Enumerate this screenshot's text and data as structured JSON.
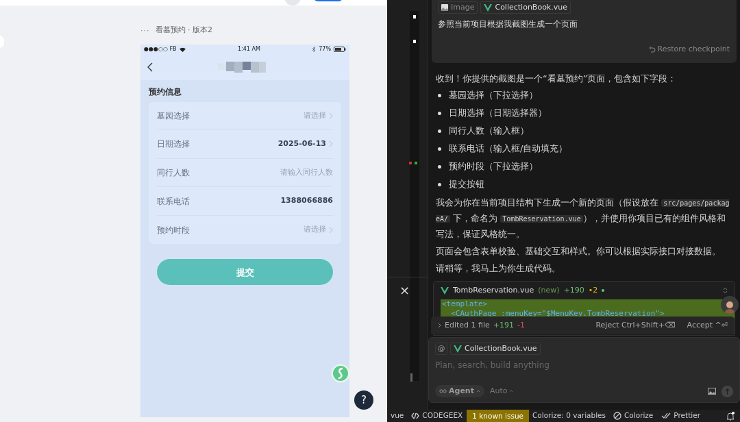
{
  "preview": {
    "more": "···",
    "breadcrumb": "看墓预约 · 版本2",
    "phone": {
      "status": {
        "carrier": "●●●○○ FB",
        "time": "1:41 AM",
        "battery": "77%"
      },
      "section_title": "预约信息",
      "fields": [
        {
          "label": "墓园选择",
          "kind": "select",
          "placeholder": "请选择"
        },
        {
          "label": "日期选择",
          "kind": "select",
          "value": "2025-06-13"
        },
        {
          "label": "同行人数",
          "kind": "input",
          "placeholder": "请输入同行人数"
        },
        {
          "label": "联系电话",
          "kind": "input",
          "value": "1388066886"
        },
        {
          "label": "预约时段",
          "kind": "select",
          "placeholder": "请选择"
        }
      ],
      "submit": "提交"
    },
    "help": "?"
  },
  "chat": {
    "user_message": {
      "attachments": [
        {
          "kind": "image",
          "label": "Image"
        },
        {
          "kind": "vue",
          "label": "CollectionBook.vue"
        }
      ],
      "text": "参照当前项目根据我截图生成一个页面",
      "restore": "Restore checkpoint"
    },
    "reply": {
      "intro": "收到！你提供的截图是一个“看墓预约”页面，包含如下字段：",
      "bullets": [
        "墓园选择（下拉选择）",
        "日期选择（日期选择器）",
        "同行人数（输入框）",
        "联系电话（输入框/自动填充）",
        "预约时段（下拉选择）",
        "提交按钮"
      ],
      "paragraphs": [
        [
          {
            "kind": "text",
            "text": "我会为你在当前项目结构下生成一个新的页面（假设放在 "
          },
          {
            "kind": "code",
            "text": "src/pages/packageA/"
          },
          {
            "kind": "text",
            "text": " 下，命名为 "
          },
          {
            "kind": "code",
            "text": "TombReservation.vue"
          },
          {
            "kind": "text",
            "text": "），并使用你项目已有的组件风格和写法，保证风格统一。"
          }
        ],
        [
          {
            "kind": "text",
            "text": "页面会包含表单校验、基础交互和样式。你可以根据实际接口对接数据。"
          }
        ],
        [
          {
            "kind": "text",
            "text": "请稍等，我马上为你生成代码。"
          }
        ]
      ]
    },
    "code_block": {
      "file": "TombReservation.vue",
      "tag": "(new)",
      "added": "+190",
      "warnings": "•2",
      "code_lines": [
        "<template>",
        "  <CAuthPage :menuKey=\"$MenuKey.TombReservation\">"
      ]
    },
    "edited_bar": {
      "summary": "Edited 1 file",
      "added": "+191",
      "removed": "-1",
      "reject": "Reject Ctrl+Shift+⌫",
      "accept": "Accept ^⏎"
    },
    "composer": {
      "mention": "@",
      "context": "CollectionBook.vue",
      "placeholder": "Plan, search, build anything",
      "mode": "Agent",
      "model": "Auto"
    }
  },
  "editor": {
    "close": "×"
  },
  "status_bar": [
    {
      "kind": "text",
      "label": "vue"
    },
    {
      "kind": "codegeex",
      "label": "CODEGEEX"
    },
    {
      "kind": "warning",
      "label": "1 known issue"
    },
    {
      "kind": "text",
      "label": "Colorize: 0 variables"
    },
    {
      "kind": "colorize",
      "label": "Colorize"
    },
    {
      "kind": "prettier",
      "label": "Prettier"
    },
    {
      "kind": "bell"
    }
  ]
}
